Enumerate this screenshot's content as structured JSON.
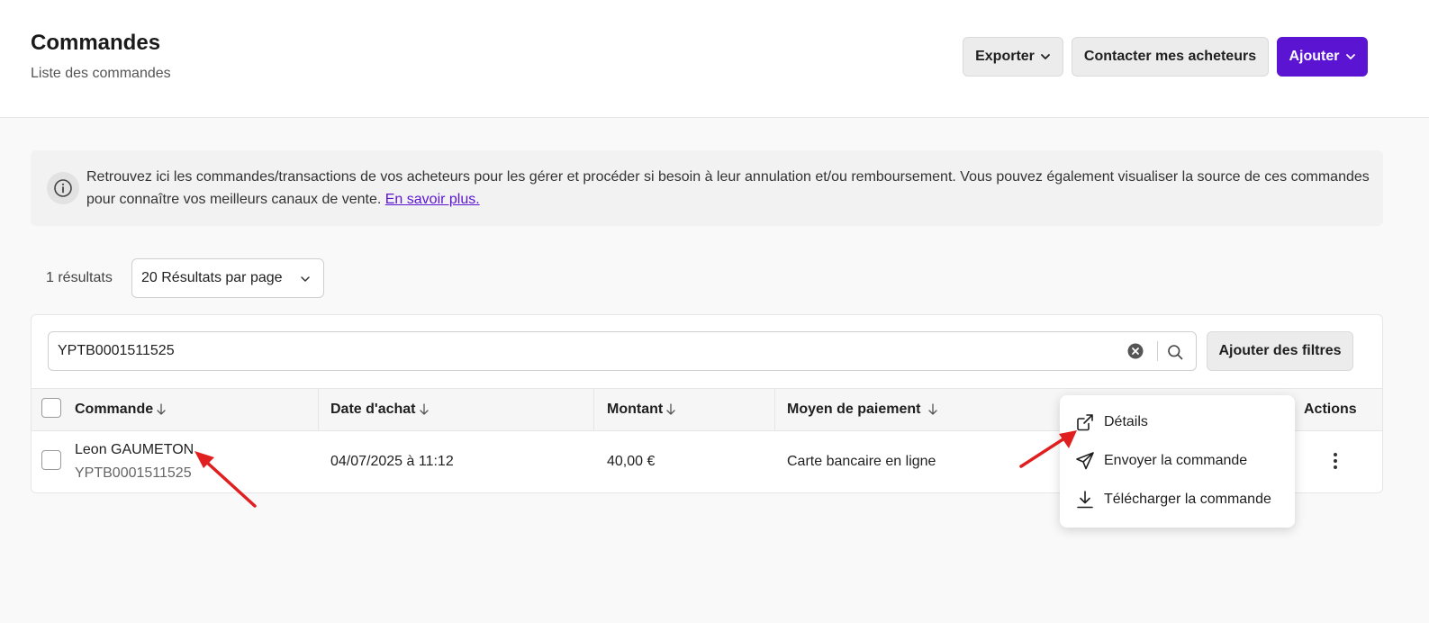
{
  "header": {
    "title": "Commandes",
    "subtitle": "Liste des commandes",
    "buttons": {
      "export": "Exporter",
      "contact": "Contacter mes acheteurs",
      "add": "Ajouter"
    }
  },
  "info": {
    "text": "Retrouvez ici les commandes/transactions de vos acheteurs pour les gérer et procéder si besoin à leur annulation et/ou remboursement. Vous pouvez également visualiser la source de ces commandes pour connaître vos meilleurs canaux de vente. ",
    "link": "En savoir plus."
  },
  "results": {
    "count": "1 résultats",
    "per_page": "20 Résultats par page"
  },
  "search": {
    "value": "YPTB0001511525",
    "filters_button": "Ajouter des filtres"
  },
  "table": {
    "columns": {
      "order": "Commande",
      "date": "Date d'achat",
      "amount": "Montant",
      "payment": "Moyen de paiement",
      "actions": "Actions"
    },
    "rows": [
      {
        "buyer": "Leon GAUMETON",
        "reference": "YPTB0001511525",
        "date": "04/07/2025 à 11:12",
        "amount": "40,00 €",
        "payment": "Carte bancaire en ligne"
      }
    ]
  },
  "actions_menu": {
    "items": [
      {
        "label": "Détails",
        "icon": "external-link-icon"
      },
      {
        "label": "Envoyer la commande",
        "icon": "send-icon"
      },
      {
        "label": "Télécharger la commande",
        "icon": "download-icon"
      }
    ]
  },
  "colors": {
    "primary": "#5b14d1",
    "annotation_arrow": "#e02020"
  }
}
